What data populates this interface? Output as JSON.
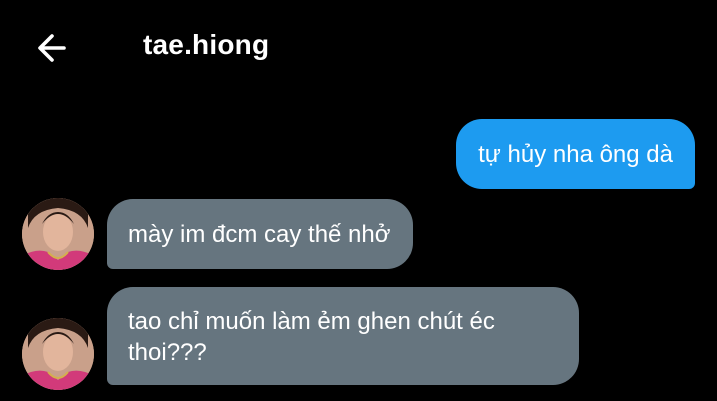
{
  "header": {
    "title": "tae.hiong",
    "back_icon": "arrow-left-icon"
  },
  "colors": {
    "background": "#000000",
    "outgoing_bubble": "#1d9bf0",
    "incoming_bubble": "#66757f",
    "text": "#ffffff"
  },
  "messages": [
    {
      "direction": "outgoing",
      "text": "tự hủy nha ông dà"
    },
    {
      "direction": "incoming",
      "text": "mày im đcm cay thế nhở"
    },
    {
      "direction": "incoming",
      "text": "tao chỉ muốn làm ẻm ghen chút éc thoi???"
    }
  ]
}
